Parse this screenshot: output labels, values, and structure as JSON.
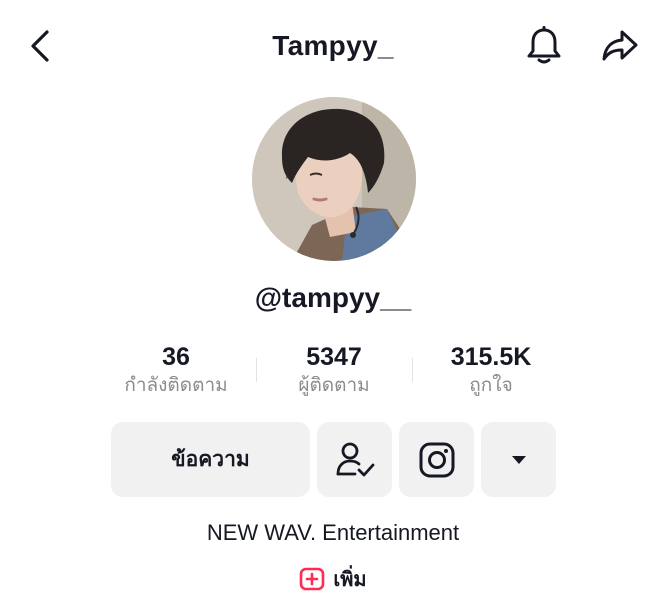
{
  "header": {
    "title": "Tampyy_",
    "back_icon": "chevron-left-icon",
    "bell_icon": "bell-icon",
    "share_icon": "share-arrow-icon"
  },
  "profile": {
    "handle": "@tampyy__",
    "bio": "NEW WAV. Entertainment",
    "add_bio_label": "เพิ่ม"
  },
  "stats": [
    {
      "value": "36",
      "label": "กำลังติดตาม"
    },
    {
      "value": "5347",
      "label": "ผู้ติดตาม"
    },
    {
      "value": "315.5K",
      "label": "ถูกใจ"
    }
  ],
  "actions": {
    "message_label": "ข้อความ",
    "friend_icon": "person-check-icon",
    "instagram_icon": "instagram-icon",
    "more_icon": "caret-down-icon"
  },
  "colors": {
    "text": "#161823",
    "secondary_text": "#8a8b91",
    "button_bg": "#f1f1f2",
    "accent": "#fe2c55"
  }
}
